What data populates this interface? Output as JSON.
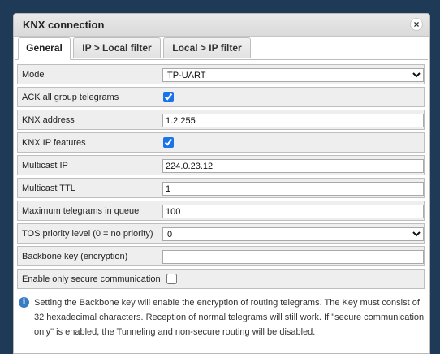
{
  "dialog": {
    "title": "KNX connection",
    "close_glyph": "×"
  },
  "tabs": [
    {
      "label": "General",
      "active": true
    },
    {
      "label": "IP > Local filter",
      "active": false
    },
    {
      "label": "Local > IP filter",
      "active": false
    }
  ],
  "form": {
    "mode": {
      "label": "Mode",
      "value": "TP-UART",
      "options": [
        "TP-UART"
      ]
    },
    "ack_all": {
      "label": "ACK all group telegrams",
      "checked": true
    },
    "knx_address": {
      "label": "KNX address",
      "value": "1.2.255"
    },
    "knx_ip_features": {
      "label": "KNX IP features",
      "checked": true
    },
    "multicast_ip": {
      "label": "Multicast IP",
      "value": "224.0.23.12"
    },
    "multicast_ttl": {
      "label": "Multicast TTL",
      "value": "1"
    },
    "max_queue": {
      "label": "Maximum telegrams in queue",
      "value": "100"
    },
    "tos_priority": {
      "label": "TOS priority level (0 = no priority)",
      "value": "0",
      "options": [
        "0"
      ]
    },
    "backbone_key": {
      "label": "Backbone key (encryption)",
      "value": ""
    },
    "secure_only": {
      "label": "Enable only secure communication",
      "checked": false
    }
  },
  "info": {
    "icon": "info-icon",
    "text": "Setting the Backbone key will enable the encryption of routing telegrams. The Key must consist of 32 hexadecimal characters. Reception of normal telegrams will still work. If \"secure communication only\" is enabled, the Tunneling and non-secure routing will be disabled."
  },
  "colors": {
    "background": "#1e3a57",
    "accent": "#1a73e8",
    "info": "#3a7cc3"
  }
}
